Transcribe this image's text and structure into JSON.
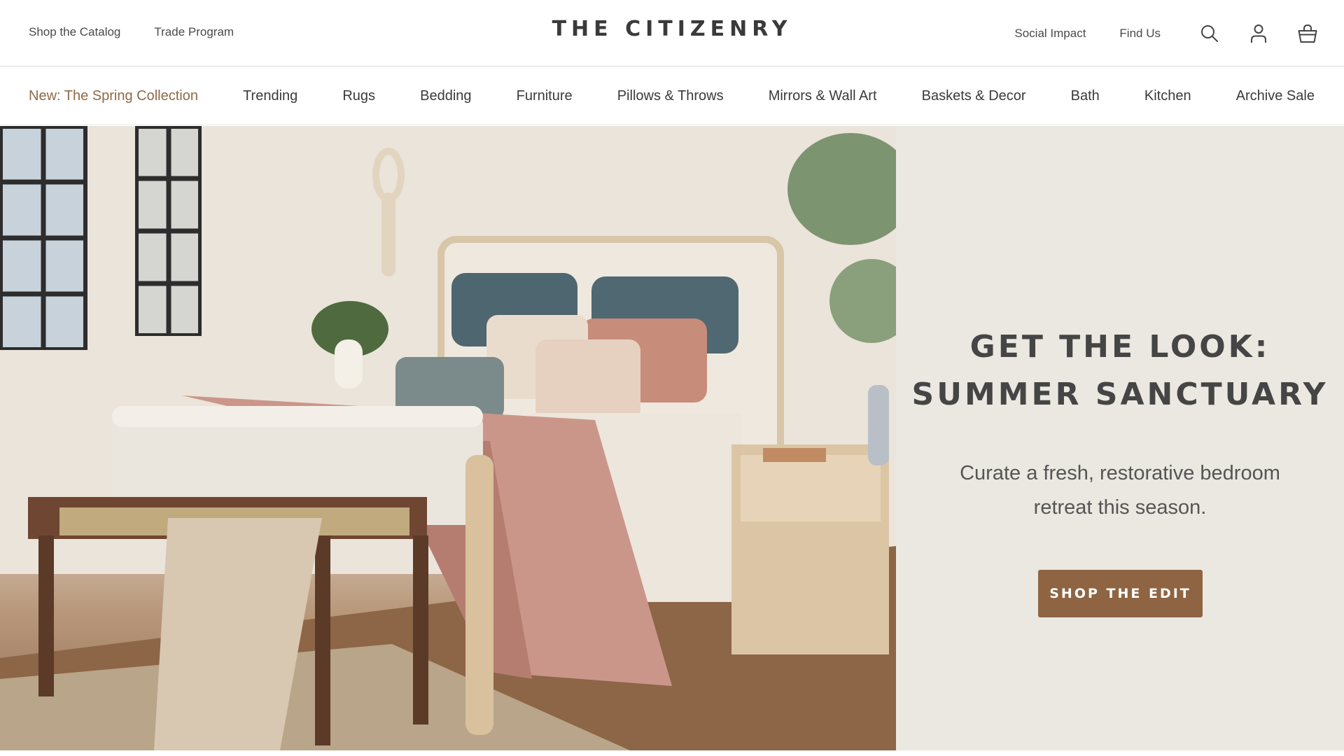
{
  "header": {
    "left_links": [
      "Shop the Catalog",
      "Trade Program"
    ],
    "logo": "THE CITIZENRY",
    "right_links": [
      "Social Impact",
      "Find Us"
    ],
    "icons": [
      "search-icon",
      "account-icon",
      "cart-basket-icon"
    ]
  },
  "nav": {
    "items": [
      "New: The Spring Collection",
      "Trending",
      "Rugs",
      "Bedding",
      "Furniture",
      "Pillows & Throws",
      "Mirrors & Wall Art",
      "Baskets & Decor",
      "Bath",
      "Kitchen",
      "Archive Sale"
    ],
    "accent_color": "#8e6a48"
  },
  "hero": {
    "title_line1": "GET THE LOOK:",
    "title_line2": "SUMMER SANCTUARY",
    "subtitle": "Curate a fresh, restorative bedroom retreat this season.",
    "cta_label": "SHOP THE EDIT",
    "cta_color": "#8e6443",
    "panel_color": "#ebe8e1",
    "image_subject": "bedroom-scene"
  }
}
